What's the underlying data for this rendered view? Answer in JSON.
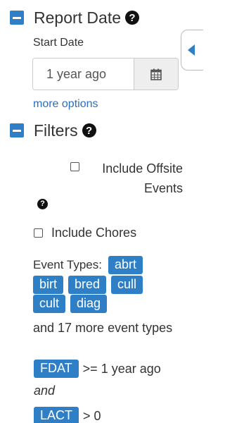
{
  "report_date": {
    "title": "Report Date",
    "start_date_label": "Start Date",
    "start_date_value": "1 year ago",
    "more_options": "more options"
  },
  "filters": {
    "title": "Filters",
    "include_offsite_events": "Include Offsite Events",
    "include_chores": "Include Chores",
    "event_types_label": "Event Types:",
    "event_type_tags": [
      "abrt",
      "birt",
      "bred",
      "cull",
      "cult",
      "diag"
    ],
    "more_event_types": "and 17 more event types",
    "conditions": [
      {
        "field": "FDAT",
        "expression": ">= 1 year ago"
      },
      {
        "field": "LACT",
        "expression": "> 0"
      }
    ],
    "conjunction": "and"
  },
  "icons": {
    "help": "question-circle-icon",
    "collapse": "minus-square-icon",
    "calendar": "calendar-icon",
    "side_tab": "caret-left-icon"
  },
  "colors": {
    "accent": "#2f7fc6",
    "link": "#2a6fc1",
    "text": "#333333"
  }
}
